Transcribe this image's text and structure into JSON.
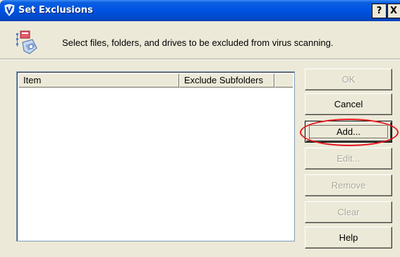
{
  "window": {
    "title": "Set Exclusions",
    "help_btn": "?",
    "close_btn": "X"
  },
  "header": {
    "instructions": "Select files, folders, and drives to be excluded from virus scanning."
  },
  "list": {
    "columns": [
      "Item",
      "Exclude Subfolders"
    ],
    "rows": []
  },
  "buttons": {
    "ok": "OK",
    "cancel": "Cancel",
    "add": "Add...",
    "edit": "Edit...",
    "remove": "Remove",
    "clear": "Clear",
    "help": "Help"
  },
  "annotation": {
    "color": "#e8141d",
    "target": "Add..."
  }
}
